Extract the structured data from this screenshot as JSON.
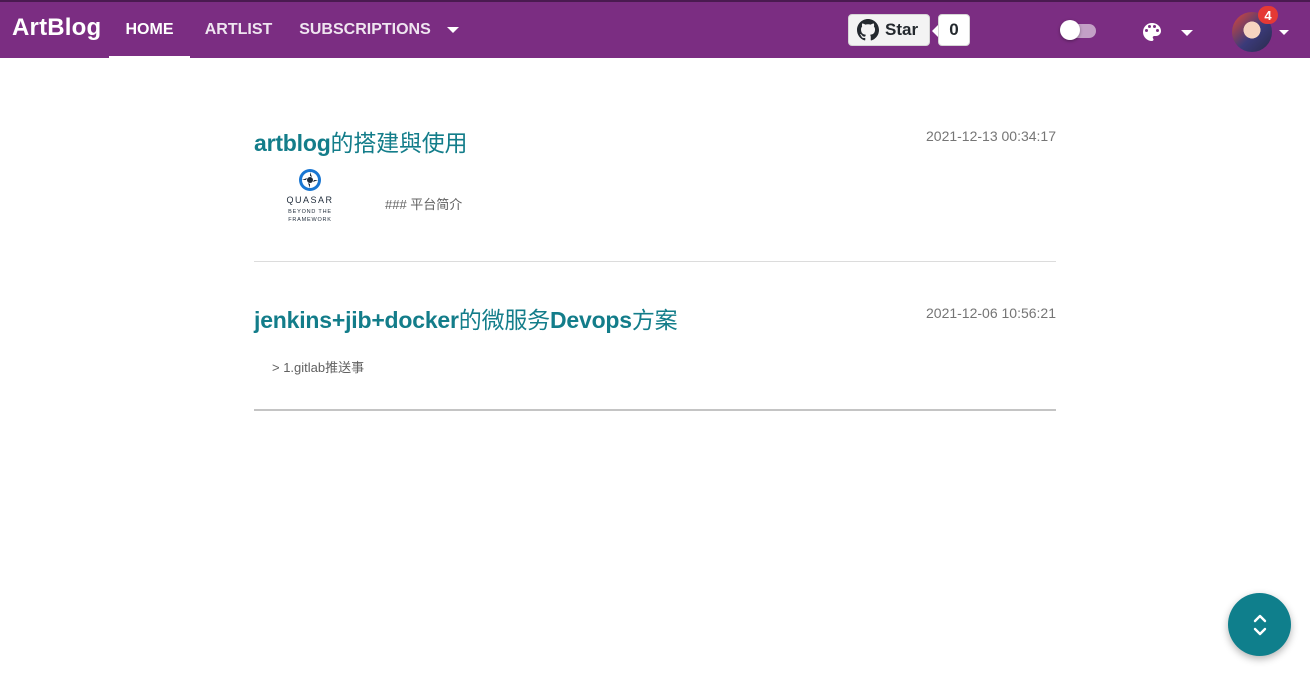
{
  "header": {
    "brand": "ArtBlog",
    "tabs": [
      {
        "label": "HOME",
        "active": true
      },
      {
        "label": "ARTLIST",
        "active": false
      },
      {
        "label": "SUBSCRIPTIONS",
        "active": false
      }
    ],
    "github": {
      "star_label": "Star",
      "count": "0",
      "icon": "github-icon"
    },
    "dark_mode_toggle": {
      "on": false
    },
    "theme_icon": "palette-icon",
    "notifications_badge": "4",
    "accent_color": "#7b2d82"
  },
  "posts": [
    {
      "title_prefix": "artblog",
      "title_rest": "的搭建與使用",
      "time": "2021-12-13 00:34:17",
      "summary": "### 平台简介",
      "thumbnail": {
        "word": "QUASAR",
        "tagline_1": "BEYOND THE",
        "tagline_2": "FRAMEWORK"
      }
    },
    {
      "title_prefix": "jenkins+jib+docker",
      "title_rest": "的微服务",
      "title_suffix": "Devops",
      "title_end": "方案",
      "time": "2021-12-06 10:56:21",
      "summary": "> 1.gitlab推送事"
    }
  ],
  "fab": {
    "icon": "scroll-up-down-icon",
    "color": "#0f7f8c"
  },
  "title_color": "#137d8a"
}
